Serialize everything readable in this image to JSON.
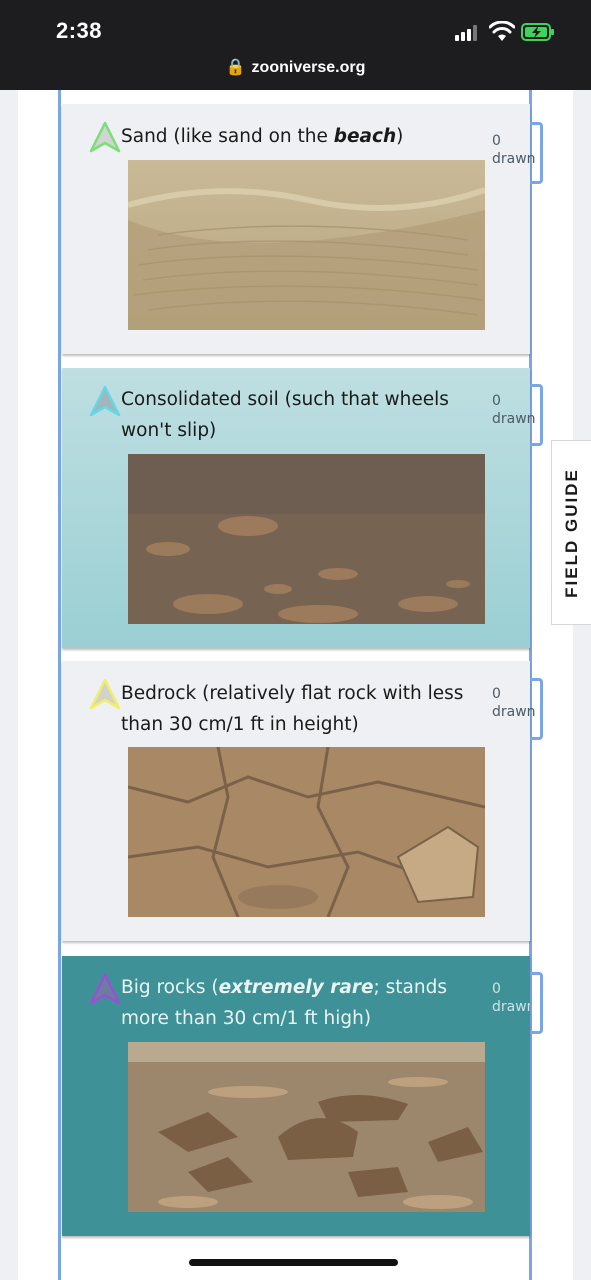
{
  "status_bar": {
    "time": "2:38",
    "url": "zooniverse.org",
    "icons": [
      "cellular-signal-icon",
      "wifi-icon",
      "battery-charging-icon"
    ]
  },
  "colors": {
    "frame": "#7ba6e6",
    "card_light": "#eef0f4",
    "card_selected": "#9acfd3",
    "card_teal": "#3e9297"
  },
  "tools": [
    {
      "label_plain": "Sand (like sand on the ",
      "label_emph": "beach",
      "label_tail": ")",
      "count": "0",
      "count_unit": "drawn",
      "icon_color": "#7fdc7a",
      "state": "default"
    },
    {
      "label_plain": "Consolidated soil (such that wheels won't slip)",
      "label_emph": "",
      "label_tail": "",
      "count": "0",
      "count_unit": "drawn",
      "icon_color": "#62d9e6",
      "state": "highlighted"
    },
    {
      "label_plain": "Bedrock (relatively flat rock with less than 30 cm/1 ft in height)",
      "label_emph": "",
      "label_tail": "",
      "count": "0",
      "count_unit": "drawn",
      "icon_color": "#f2ee6a",
      "state": "default"
    },
    {
      "label_plain": "Big rocks (",
      "label_emph": "extremely rare",
      "label_tail": "; stands more than 30 cm/1 ft high)",
      "count": "0",
      "count_unit": "drawn",
      "icon_color": "#9a4fd6",
      "state": "selected"
    }
  ],
  "field_guide": {
    "label": "FIELD GUIDE"
  }
}
